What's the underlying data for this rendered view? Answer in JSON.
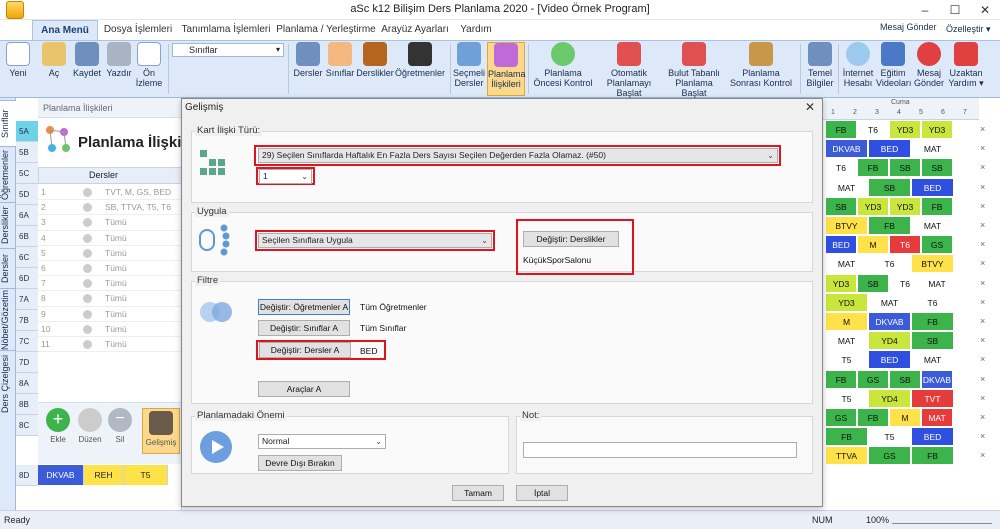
{
  "app": {
    "title": "aSc k12 Bilişim Ders Planlama 2020  - [Video Örnek Program]",
    "right_links": {
      "mesaj": "Mesaj Gönder",
      "ozellestir": "Özelleştir ▾"
    }
  },
  "tabs": [
    "Ana Menü",
    "Dosya İşlemleri",
    "Tanımlama İşlemleri",
    "Planlama / Yerleştirme",
    "Arayüz Ayarları",
    "Yardım"
  ],
  "ribbon": {
    "yeni": "Yeni",
    "ac": "Aç",
    "kaydet": "Kaydet",
    "yazdir": "Yazdır",
    "on_izleme": "Ön İzleme",
    "select_value": "Sınıflar",
    "dersler": "Dersler",
    "siniflar": "Sınıflar",
    "derslikler": "Derslikler",
    "ogretmenler": "Öğretmenler",
    "secmeli": "Seçmeli Dersler",
    "planlama_iliskileri": "Planlama İlişkileri",
    "planlama_oncesi": "Planlama Öncesi Kontrol",
    "otomatik": "Otomatik Planlamayı Başlat",
    "bulut": "Bulut Tabanlı Planlama Başlat",
    "sonrasi": "Planlama Sonrası Kontrol",
    "temel": "Temel Bilgiler",
    "internet": "İnternet Hesabı",
    "egitim": "Eğitim Videoları",
    "mesaj": "Mesaj Gönder",
    "uzaktan": "Uzaktan Yardım ▾"
  },
  "left_tabs": [
    "Sınıflar",
    "Öğretmenler",
    "Derslikler",
    "Dersler",
    "Nöbet/Gözetim",
    "Ders Çizelgesi"
  ],
  "classes": [
    "5A",
    "5B",
    "5C",
    "5D",
    "6A",
    "6B",
    "6C",
    "6D",
    "7A",
    "7B",
    "7C",
    "7D",
    "8A",
    "8B",
    "8C",
    "8D"
  ],
  "panel": {
    "header": "Planlama İlişkileri",
    "title": "Planlama İlişkileri",
    "col": "Dersler",
    "rows": [
      {
        "n": "1",
        "t": "TVT, M, GS, BED"
      },
      {
        "n": "2",
        "t": "SB, TTVA, T5, T6"
      },
      {
        "n": "3",
        "t": "Tümü"
      },
      {
        "n": "4",
        "t": "Tümü"
      },
      {
        "n": "5",
        "t": "Tümü"
      },
      {
        "n": "6",
        "t": "Tümü"
      },
      {
        "n": "7",
        "t": "Tümü"
      },
      {
        "n": "8",
        "t": "Tümü"
      },
      {
        "n": "9",
        "t": "Tümü"
      },
      {
        "n": "10",
        "t": "Tümü"
      },
      {
        "n": "11",
        "t": "Tümü"
      }
    ],
    "btn_ekle": "Ekle",
    "btn_duzen": "Düzen",
    "btn_sil": "Sil",
    "btn_gelismis": "Gelişmiş"
  },
  "dialog": {
    "title": "Gelişmiş",
    "kart_label": "Kart İlişki Türü:",
    "kart_value": "29) Seçilen Sınıflarda Haftalık En Fazla Ders Sayısı Seçilen Değerden Fazla Olamaz. (#50)",
    "kart_num": "1",
    "uygula_label": "Uygula",
    "uygula_value": "Seçilen Sınıflara Uygula",
    "degistir_derslikler": "Değiştir: Derslikler",
    "derslik_value": "KüçükSporSalonu",
    "filtre_label": "Filtre",
    "btn_ogretmenler": "Değiştir: Öğretmenler A",
    "val_ogretmenler": "Tüm Öğretmenler",
    "btn_siniflar": "Değiştir: Sınıflar A",
    "val_siniflar": "Tüm Sınıflar",
    "btn_dersler": "Değiştir: Dersler A",
    "val_dersler": "BED",
    "btn_araclar": "Araçlar A",
    "onem_label": "Planlamadaki Önemi",
    "onem_value": "Normal",
    "btn_devre": "Devre Dışı Bırakın",
    "not_label": "Not:",
    "btn_tamam": "Tamam",
    "btn_iptal": "İptal"
  },
  "timetable": {
    "day_label": "Cuma",
    "periods": [
      "1",
      "2",
      "3",
      "4",
      "5",
      "6",
      "7"
    ],
    "rows": [
      [
        {
          "t": "FB",
          "c": "#3cb44b"
        },
        {
          "t": "T6",
          "c": "#ffffff"
        },
        {
          "t": "YD3",
          "c": "#c8e63c"
        },
        {
          "t": "YD3",
          "c": "#c8e63c"
        }
      ],
      [
        {
          "t": "DKVAB",
          "c": "#3b5bd9"
        },
        {
          "t": "BED",
          "c": "#2f4fe0"
        },
        {
          "t": "MAT",
          "c": "#ffffff"
        }
      ],
      [
        {
          "t": "T6",
          "c": "#ffffff"
        },
        {
          "t": "FB",
          "c": "#3cb44b"
        },
        {
          "t": "SB",
          "c": "#3cb44b"
        },
        {
          "t": "SB",
          "c": "#3cb44b"
        }
      ],
      [
        {
          "t": "MAT",
          "c": "#ffffff"
        },
        {
          "t": "SB",
          "c": "#3cb44b"
        },
        {
          "t": "BED",
          "c": "#2f4fe0"
        }
      ],
      [
        {
          "t": "SB",
          "c": "#3cb44b"
        },
        {
          "t": "YD3",
          "c": "#c8e63c"
        },
        {
          "t": "YD3",
          "c": "#c8e63c"
        },
        {
          "t": "FB",
          "c": "#3cb44b"
        }
      ],
      [
        {
          "t": "BTVY",
          "c": "#ffe24a"
        },
        {
          "t": "FB",
          "c": "#3cb44b"
        },
        {
          "t": "MAT",
          "c": "#ffffff"
        }
      ],
      [
        {
          "t": "BED",
          "c": "#2f4fe0"
        },
        {
          "t": "M",
          "c": "#ffe24a"
        },
        {
          "t": "T6",
          "c": "#e53b3b"
        },
        {
          "t": "GS",
          "c": "#3cb44b"
        }
      ],
      [
        {
          "t": "MAT",
          "c": "#ffffff"
        },
        {
          "t": "T6",
          "c": "#ffffff"
        },
        {
          "t": "BTVY",
          "c": "#ffe24a"
        }
      ],
      [
        {
          "t": "YD3",
          "c": "#c8e63c"
        },
        {
          "t": "SB",
          "c": "#3cb44b"
        },
        {
          "t": "T6",
          "c": "#ffffff"
        },
        {
          "t": "MAT",
          "c": "#ffffff"
        }
      ],
      [
        {
          "t": "YD3",
          "c": "#c8e63c"
        },
        {
          "t": "MAT",
          "c": "#ffffff"
        },
        {
          "t": "T6",
          "c": "#ffffff"
        }
      ],
      [
        {
          "t": "M",
          "c": "#ffe24a"
        },
        {
          "t": "DKVAB",
          "c": "#3b5bd9"
        },
        {
          "t": "FB",
          "c": "#3cb44b"
        }
      ],
      [
        {
          "t": "MAT",
          "c": "#ffffff"
        },
        {
          "t": "YD4",
          "c": "#c8e63c"
        },
        {
          "t": "SB",
          "c": "#3cb44b"
        }
      ],
      [
        {
          "t": "T5",
          "c": "#ffffff"
        },
        {
          "t": "BED",
          "c": "#2f4fe0"
        },
        {
          "t": "MAT",
          "c": "#ffffff"
        }
      ],
      [
        {
          "t": "FB",
          "c": "#3cb44b"
        },
        {
          "t": "GS",
          "c": "#3cb44b"
        },
        {
          "t": "SB",
          "c": "#3cb44b"
        },
        {
          "t": "DKVAB",
          "c": "#3b5bd9"
        }
      ],
      [
        {
          "t": "T5",
          "c": "#ffffff"
        },
        {
          "t": "YD4",
          "c": "#c8e63c"
        },
        {
          "t": "TVT",
          "c": "#e53b3b"
        }
      ],
      [
        {
          "t": "GS",
          "c": "#3cb44b"
        },
        {
          "t": "FB",
          "c": "#3cb44b"
        },
        {
          "t": "M",
          "c": "#ffe24a"
        },
        {
          "t": "MAT",
          "c": "#e53b3b"
        }
      ],
      [
        {
          "t": "FB",
          "c": "#3cb44b"
        },
        {
          "t": "T5",
          "c": "#ffffff"
        },
        {
          "t": "BED",
          "c": "#2f4fe0"
        }
      ],
      [
        {
          "t": "TTVA",
          "c": "#ffe24a"
        },
        {
          "t": "GS",
          "c": "#3cb44b"
        },
        {
          "t": "FB",
          "c": "#3cb44b"
        }
      ]
    ]
  },
  "bottom_row": {
    "c1": "DKVAB",
    "c2": "REH",
    "c3": "T5"
  },
  "status": {
    "ready": "Ready",
    "num": "NUM",
    "zoom": "100%"
  }
}
